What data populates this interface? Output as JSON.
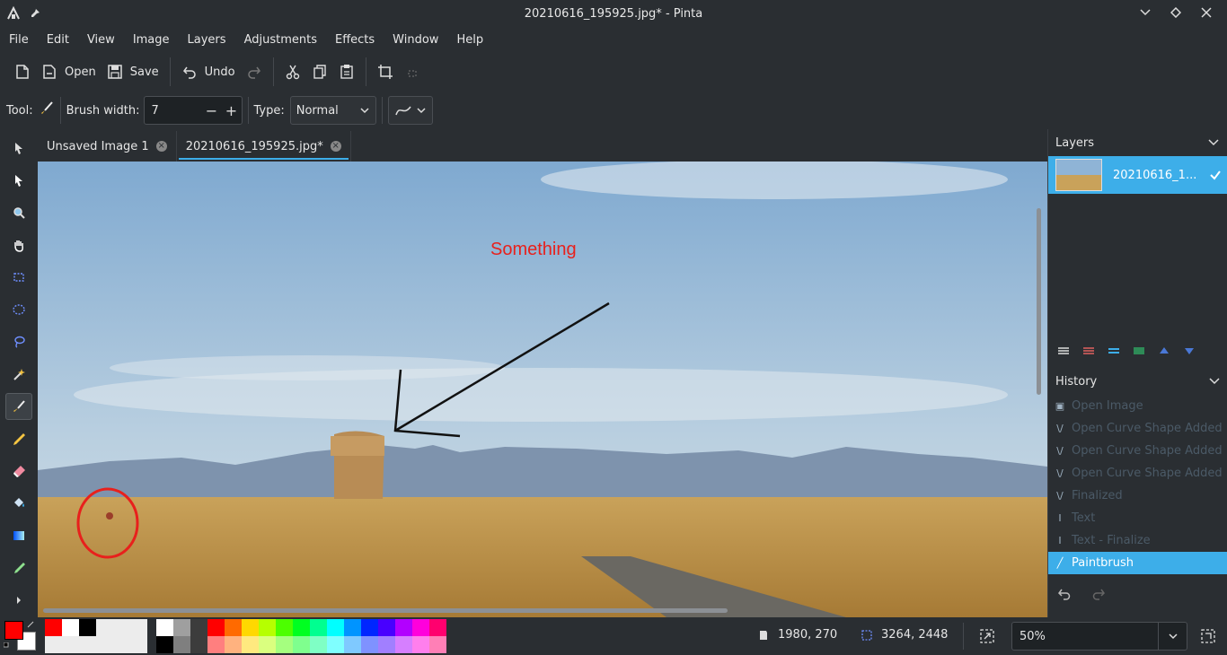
{
  "window": {
    "title": "20210616_195925.jpg* - Pinta"
  },
  "menu": [
    "File",
    "Edit",
    "View",
    "Image",
    "Layers",
    "Adjustments",
    "Effects",
    "Window",
    "Help"
  ],
  "toolbar": {
    "open_label": "Open",
    "save_label": "Save",
    "undo_label": "Undo"
  },
  "tool_options": {
    "tool_label": "Tool:",
    "brush_width_label": "Brush width:",
    "brush_width_value": "7",
    "type_label": "Type:",
    "type_value": "Normal"
  },
  "tabs": [
    {
      "label": "Unsaved Image 1",
      "active": false
    },
    {
      "label": "20210616_195925.jpg*",
      "active": true
    }
  ],
  "canvas": {
    "annotation_text": "Something",
    "annotation_color": "#e8201c"
  },
  "layers": {
    "title": "Layers",
    "items": [
      {
        "name": "20210616_1...",
        "selected": true
      }
    ]
  },
  "history": {
    "title": "History",
    "items": [
      {
        "label": "Open Image",
        "icon": "image-icon"
      },
      {
        "label": "Open Curve Shape Added",
        "icon": "curve-icon"
      },
      {
        "label": "Open Curve Shape Added",
        "icon": "curve-icon"
      },
      {
        "label": "Open Curve Shape Added",
        "icon": "curve-icon"
      },
      {
        "label": "Finalized",
        "icon": "curve-icon"
      },
      {
        "label": "Text",
        "icon": "text-icon"
      },
      {
        "label": "Text - Finalize",
        "icon": "text-icon"
      },
      {
        "label": "Paintbrush",
        "icon": "paintbrush-icon",
        "selected": true
      }
    ]
  },
  "status": {
    "cursor_position": "1980, 270",
    "image_size": "3264, 2448",
    "zoom": "50%"
  },
  "colors": {
    "primary": "#ff0000",
    "secondary": "#ffffff",
    "accent": "#3daee9",
    "palette_top": [
      "#ff0000",
      "#ffffff",
      "#000000",
      "#ececec",
      "#ececec",
      "#ececec",
      "#ffffff",
      "#9f9f9f",
      "#3c3c3c",
      "#ff0000",
      "#ff6a00",
      "#ffd800",
      "#b6ff00",
      "#4cff00",
      "#00ff21",
      "#00ff90",
      "#00ffff",
      "#0094ff",
      "#0026ff",
      "#4800ff",
      "#b200ff",
      "#ff00dc",
      "#ff006e"
    ],
    "palette_bottom": [
      "#ececec",
      "#ececec",
      "#ececec",
      "#ececec",
      "#ececec",
      "#ececec",
      "#000000",
      "#7f7f7f",
      "#3c3c3c",
      "#ff7f7f",
      "#ffb27f",
      "#ffe97f",
      "#daff7f",
      "#a5ff7f",
      "#7fff8e",
      "#7fffc5",
      "#7fffff",
      "#7fc9ff",
      "#7f92ff",
      "#a17fff",
      "#d67fff",
      "#ff7fed",
      "#ff7fb6"
    ]
  }
}
